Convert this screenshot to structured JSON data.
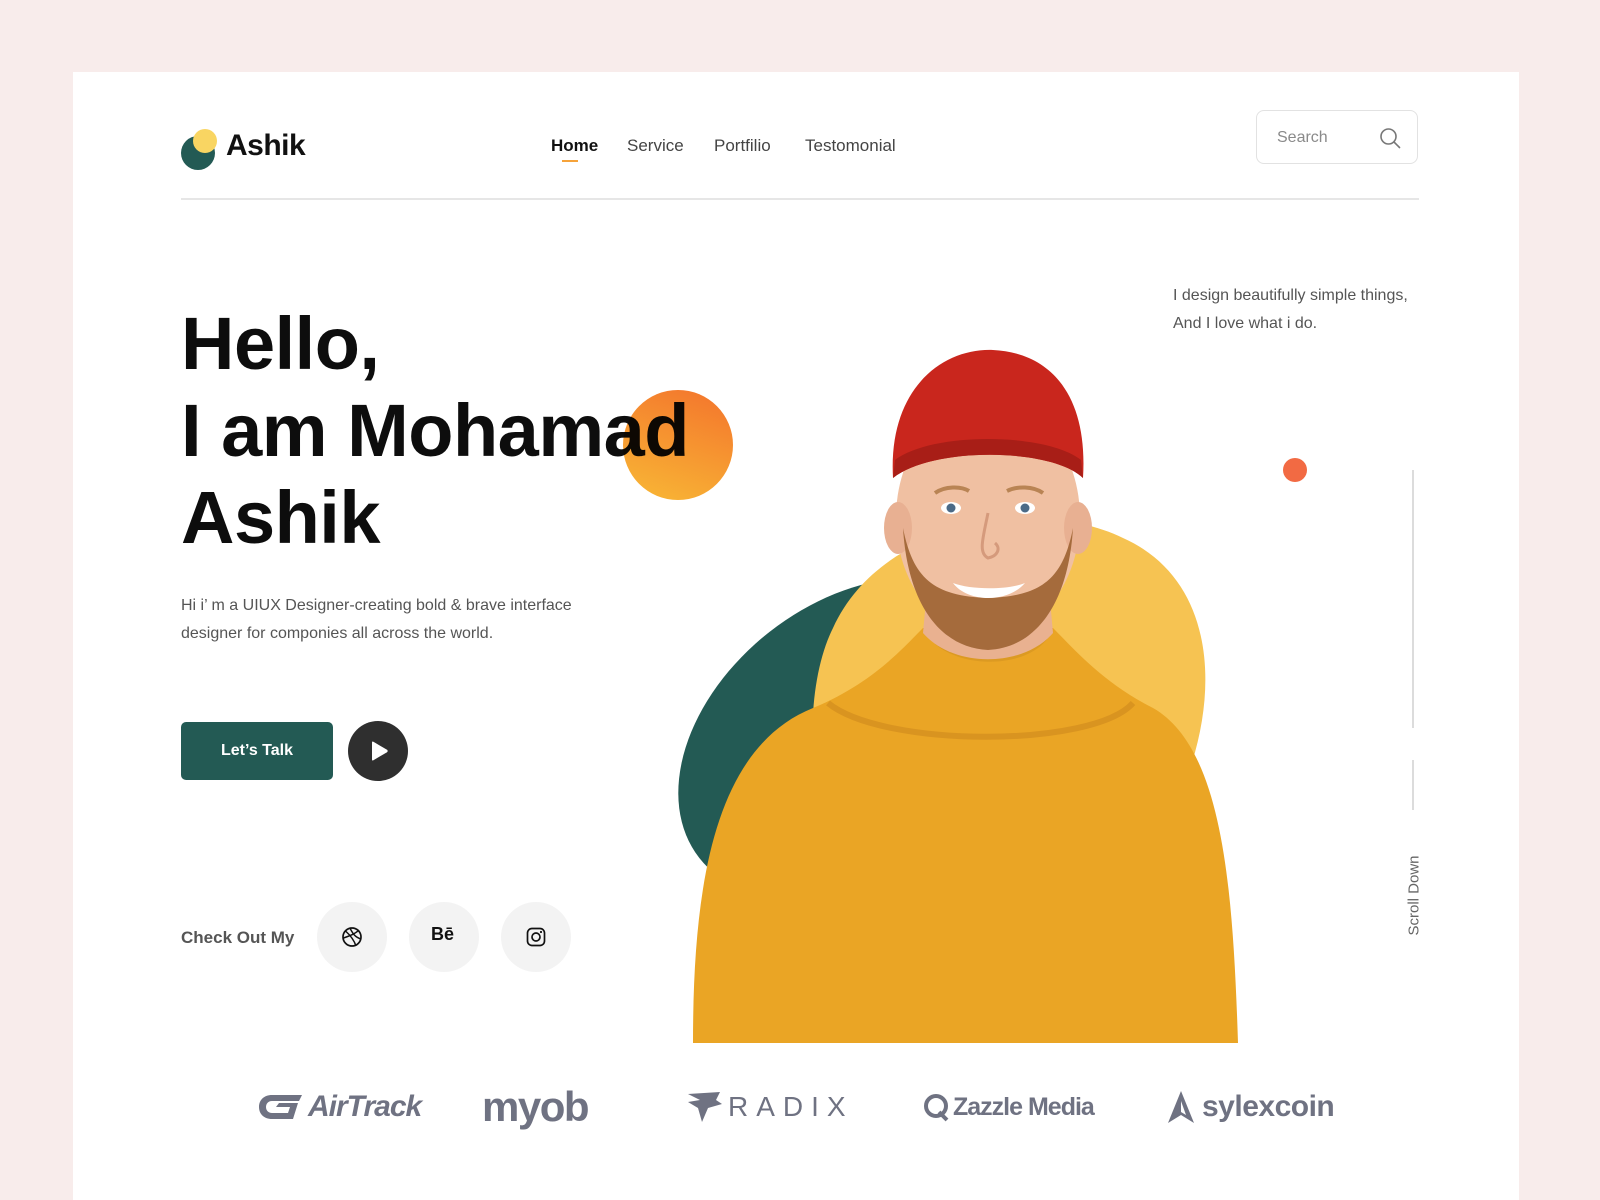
{
  "logo": {
    "text": "Ashik"
  },
  "nav": {
    "items": [
      {
        "label": "Home",
        "active": true
      },
      {
        "label": "Service",
        "active": false
      },
      {
        "label": "Portfilio",
        "active": false
      },
      {
        "label": "Testomonial",
        "active": false
      }
    ]
  },
  "search": {
    "placeholder": "Search"
  },
  "hero": {
    "title_lines": [
      "Hello,",
      "I am Mohamad",
      "Ashik"
    ],
    "description": "Hi i’ m a UIUX Designer-creating bold & brave interface designer for componies all across the world.",
    "cta_label": "Let’s Talk",
    "tagline": "I design beautifully simple things, And I love what i do."
  },
  "social": {
    "label": "Check Out My",
    "items": [
      {
        "name": "dribbble",
        "icon": "dribbble-icon"
      },
      {
        "name": "behance",
        "icon": "behance-icon",
        "text": "Bē"
      },
      {
        "name": "instagram",
        "icon": "instagram-icon"
      }
    ]
  },
  "scroll": {
    "label": "Scroll Down"
  },
  "brands": [
    "AirTrack",
    "myob",
    "RADIX",
    "Zazzle Media",
    "sylexcoin"
  ],
  "colors": {
    "background": "#f8eceb",
    "primary": "#235a54",
    "accent_orange": "#f47a2d",
    "accent_yellow": "#f6c352",
    "dot": "#f26a43"
  }
}
